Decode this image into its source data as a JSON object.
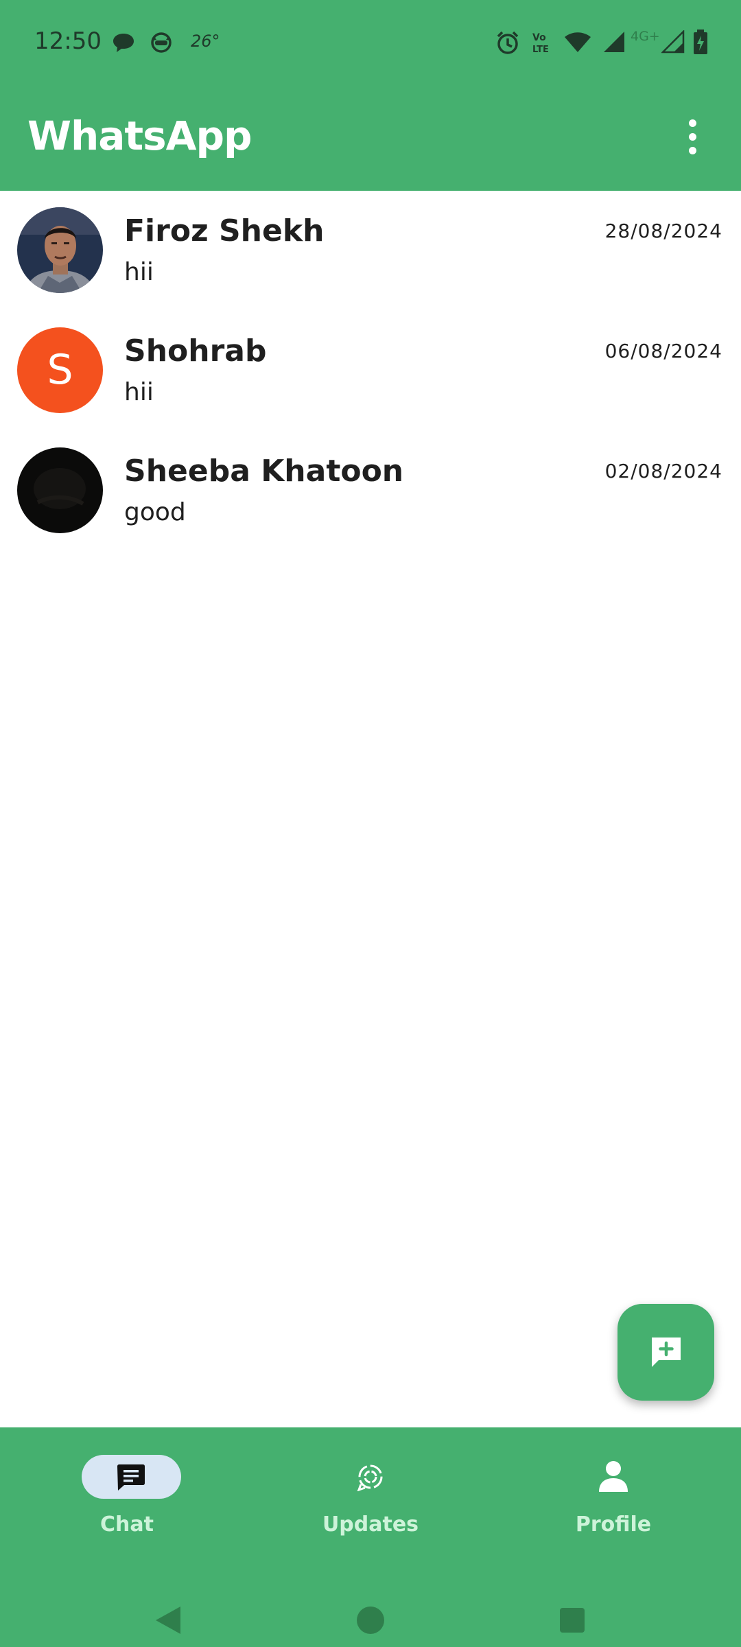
{
  "status_bar": {
    "time": "12:50",
    "temperature": "26°",
    "network": "4G+",
    "icons": [
      "chat-bubble-icon",
      "cat-face-icon",
      "alarm-icon",
      "volte-icon",
      "wifi-icon",
      "signal-icon",
      "signal-icon",
      "battery-charging-icon"
    ]
  },
  "app_bar": {
    "title": "WhatsApp",
    "menu_icon": "more-vert-icon"
  },
  "chats": [
    {
      "name": "Firoz Shekh",
      "message": "hii",
      "date": "28/08/2024",
      "avatar": "photo"
    },
    {
      "name": "Shohrab",
      "message": "hii",
      "date": "06/08/2024",
      "avatar": "letter",
      "avatar_letter": "S",
      "avatar_color": "#f4511e"
    },
    {
      "name": "Sheeba Khatoon",
      "message": "good",
      "date": "02/08/2024",
      "avatar": "photo"
    }
  ],
  "fab": {
    "icon": "new-chat-icon"
  },
  "bottom_nav": {
    "items": [
      {
        "label": "Chat",
        "icon": "chat-icon",
        "selected": true
      },
      {
        "label": "Updates",
        "icon": "updates-icon",
        "selected": false
      },
      {
        "label": "Profile",
        "icon": "profile-icon",
        "selected": false
      }
    ]
  },
  "system_nav": [
    "back-icon",
    "home-icon",
    "recents-icon"
  ],
  "colors": {
    "primary": "#45b06f",
    "nav_selected_pill": "#d8e6f4",
    "nav_label": "#cdf3d9",
    "avatar_orange": "#f4511e"
  }
}
